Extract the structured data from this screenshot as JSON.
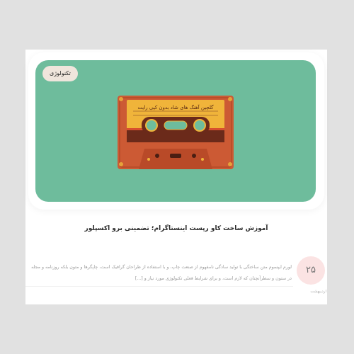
{
  "post": {
    "category": "تکنولوژی",
    "title": "آموزش ساخت کاو رپست اینستاگرام؛ تضمینی برو اکسپلور",
    "excerpt": "لورم ایپسوم متن ساختگی با تولید سادگی نامفهوم از صنعت چاپ، و با استفاده از طراحان گرافیک است، چاپگرها و متون بلکه روزنامه و مجله در ستون و سطرآنچنان که لازم است، و برای شرایط فعلی تکنولوژی مورد نیاز و [...]",
    "count": "۲۵",
    "meta": "اردیبهشت"
  },
  "image": {
    "cassette_label": "گلچین آهنگ های شاد بدون کپی رایت",
    "icon": "cassette-tape-image"
  },
  "colors": {
    "background": "#e1e1e1",
    "image_bg": "#6ebc9c",
    "badge_bg": "#efe5dc",
    "count_bg": "#fbe3e3",
    "cassette_body": "#cc5a34",
    "cassette_label": "#f0b43a"
  }
}
